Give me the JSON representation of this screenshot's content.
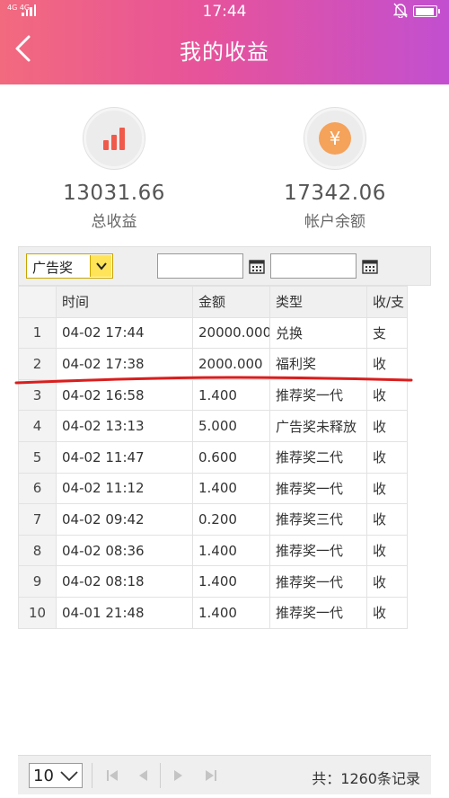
{
  "status_bar": {
    "network": "4G 4G",
    "time": "17:44"
  },
  "header": {
    "title": "我的收益",
    "back_icon": "chevron-left-icon"
  },
  "summary": {
    "total_income": {
      "value": "13031.66",
      "label": "总收益",
      "icon": "bar-chart-icon",
      "icon_color": "#f05a4a"
    },
    "balance": {
      "value": "17342.06",
      "label": "帐户余额",
      "icon": "yen-coin-icon",
      "icon_color": "#f5a25a"
    }
  },
  "filter": {
    "type_select": "广告奖",
    "start_date": "",
    "end_date": ""
  },
  "table": {
    "headers": [
      "时间",
      "金额",
      "类型",
      "收/支"
    ],
    "rows": [
      {
        "no": "1",
        "time": "04-02 17:44",
        "amount": "20000.000",
        "type": "兑换",
        "flow": "支"
      },
      {
        "no": "2",
        "time": "04-02 17:38",
        "amount": "2000.000",
        "type": "福利奖",
        "flow": "收"
      },
      {
        "no": "3",
        "time": "04-02 16:58",
        "amount": "1.400",
        "type": "推荐奖一代",
        "flow": "收"
      },
      {
        "no": "4",
        "time": "04-02 13:13",
        "amount": "5.000",
        "type": "广告奖未释放",
        "flow": "收"
      },
      {
        "no": "5",
        "time": "04-02 11:47",
        "amount": "0.600",
        "type": "推荐奖二代",
        "flow": "收"
      },
      {
        "no": "6",
        "time": "04-02 11:12",
        "amount": "1.400",
        "type": "推荐奖一代",
        "flow": "收"
      },
      {
        "no": "7",
        "time": "04-02 09:42",
        "amount": "0.200",
        "type": "推荐奖三代",
        "flow": "收"
      },
      {
        "no": "8",
        "time": "04-02 08:36",
        "amount": "1.400",
        "type": "推荐奖一代",
        "flow": "收"
      },
      {
        "no": "9",
        "time": "04-02 08:18",
        "amount": "1.400",
        "type": "推荐奖一代",
        "flow": "收"
      },
      {
        "no": "10",
        "time": "04-01 21:48",
        "amount": "1.400",
        "type": "推荐奖一代",
        "flow": "收"
      }
    ]
  },
  "pager": {
    "page_size": "10",
    "total": "共：1260条记录"
  },
  "colors": {
    "header_gradient_start": "#f26a7e",
    "header_gradient_end": "#c24fd0",
    "annotation_red": "#d91e1e"
  }
}
